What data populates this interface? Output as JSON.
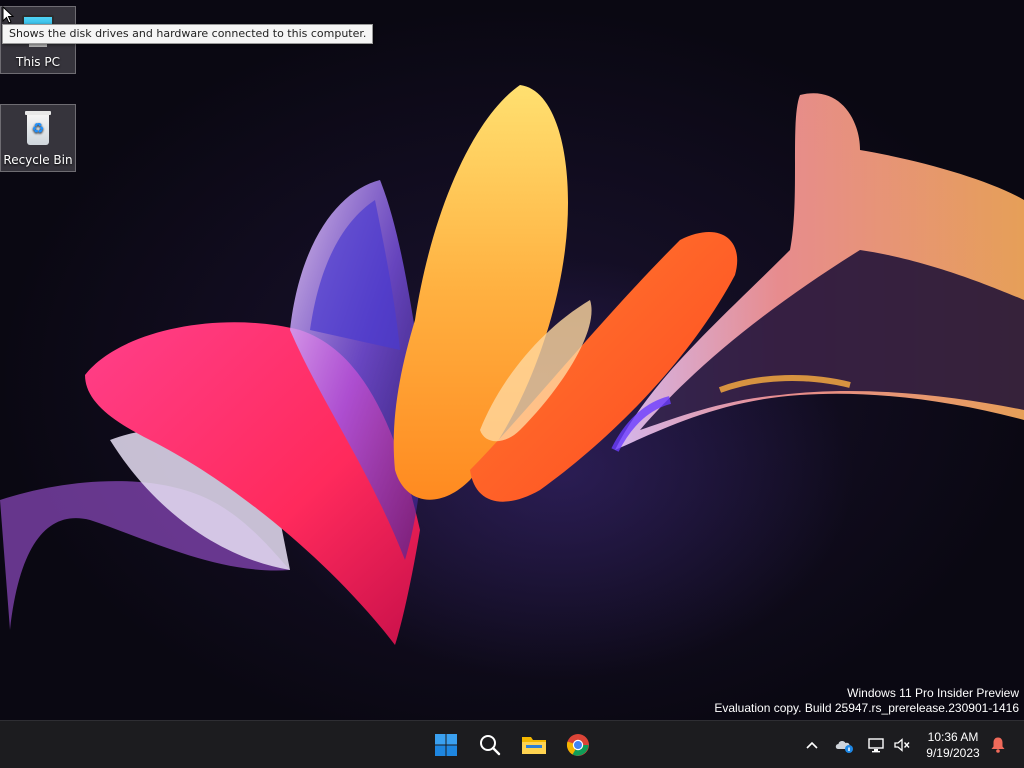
{
  "desktop": {
    "icons": [
      {
        "label": "This PC",
        "icon": "monitor-icon"
      },
      {
        "label": "Recycle Bin",
        "icon": "recycle-bin-icon"
      }
    ],
    "tooltip": "Shows the disk drives and hardware connected to this computer.",
    "watermark": {
      "line1": "Windows 11 Pro Insider Preview",
      "line2": "Evaluation copy. Build 25947.rs_prerelease.230901-1416"
    }
  },
  "taskbar": {
    "apps": [
      {
        "name": "start",
        "icon": "windows-logo-icon"
      },
      {
        "name": "search",
        "icon": "search-icon"
      },
      {
        "name": "file-explorer",
        "icon": "folder-icon"
      },
      {
        "name": "chrome",
        "icon": "chrome-icon"
      }
    ],
    "tray": {
      "icons": [
        "chevron-up-icon",
        "onedrive-icon",
        "network-icon",
        "volume-muted-icon",
        "notification-bell-icon"
      ],
      "time": "10:36 AM",
      "date": "9/19/2023"
    }
  },
  "colors": {
    "taskbar_bg": "#1c1c1f",
    "accent_blue": "#0078d4"
  }
}
